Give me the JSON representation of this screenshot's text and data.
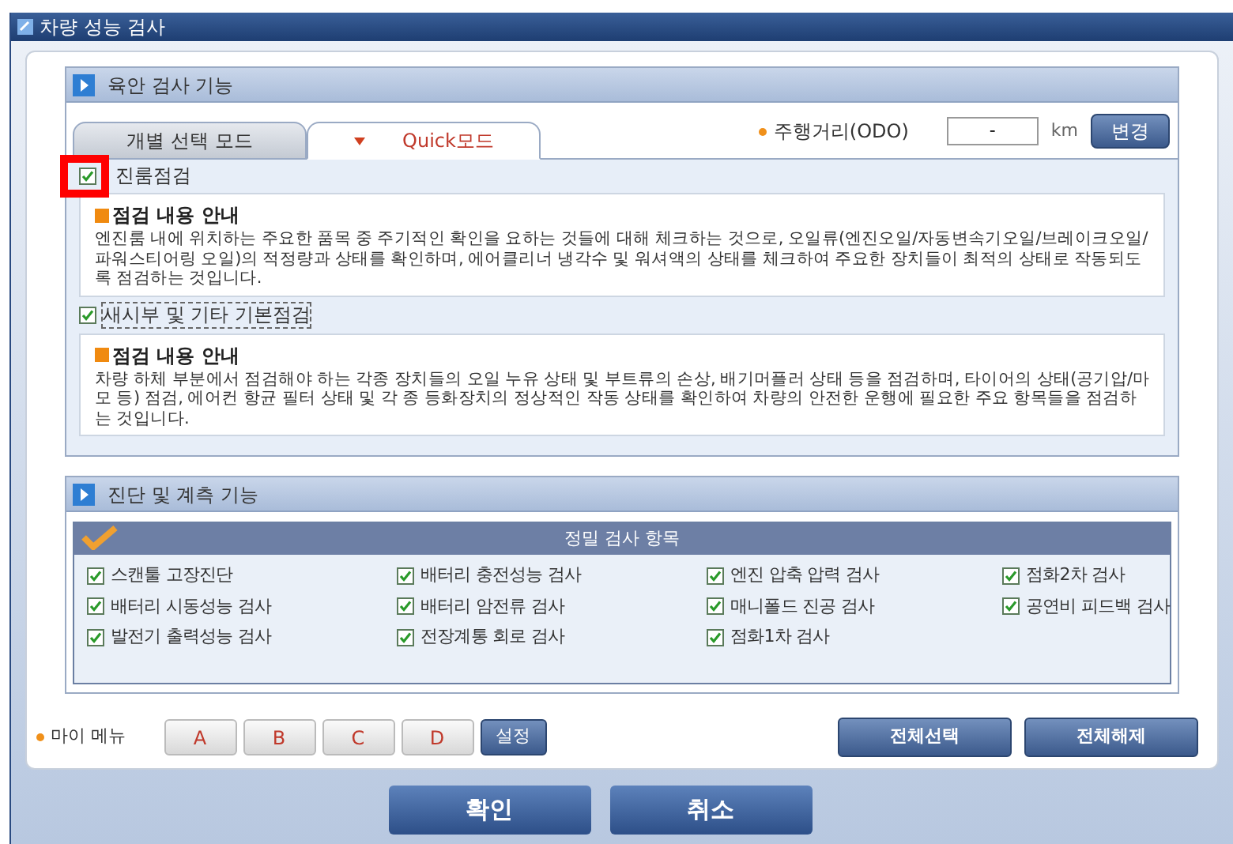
{
  "window": {
    "title": "차량 성능 검사"
  },
  "section1": {
    "title": "육안 검사 기능",
    "tabs": [
      {
        "label": "개별 선택 모드",
        "selected": false
      },
      {
        "label": "Quick모드",
        "selected": true
      }
    ],
    "odo": {
      "label": "주행거리(ODO)",
      "value": "-",
      "unit": "km",
      "button": "변경"
    },
    "groups": [
      {
        "label": "진룸점검",
        "checked": true,
        "highlighted": true,
        "info_title": "점검 내용 안내",
        "info_text": "엔진룸 내에 위치하는 주요한 품목 중 주기적인 확인을 요하는 것들에 대해 체크하는 것으로, 오일류(엔진오일/자동변속기오일/브레이크오일/파워스티어링 오일)의 적정량과 상태를 확인하며, 에어클리너 냉각수 및 워셔액의 상태를 체크하여 주요한 장치들이 최적의 상태로 작동되도록 점검하는 것입니다."
      },
      {
        "label": "새시부 및 기타 기본점검",
        "checked": true,
        "highlighted": false,
        "info_title": "점검 내용 안내",
        "info_text": "차량 하체 부분에서 점검해야 하는 각종 장치들의 오일 누유 상태 및 부트류의 손상, 배기머플러 상태 등을 점검하며, 타이어의 상태(공기압/마모 등) 점검, 에어컨 항균 필터 상태 및 각 종 등화장치의 정상적인 작동 상태를 확인하여 차량의 안전한 운행에 필요한 주요 항목들을 점검하는 것입니다."
      }
    ]
  },
  "section2": {
    "title": "진단 및 계측 기능",
    "panel_title": "정밀 검사 항목",
    "items": [
      {
        "label": "스캔툴 고장진단",
        "checked": true
      },
      {
        "label": "배터리 충전성능 검사",
        "checked": true
      },
      {
        "label": "엔진 압축 압력 검사",
        "checked": true
      },
      {
        "label": "점화2차 검사",
        "checked": true
      },
      {
        "label": "배터리 시동성능 검사",
        "checked": true
      },
      {
        "label": "배터리 암전류 검사",
        "checked": true
      },
      {
        "label": "매니폴드 진공 검사",
        "checked": true
      },
      {
        "label": "공연비 피드백 검사",
        "checked": true
      },
      {
        "label": "발전기 출력성능 검사",
        "checked": true
      },
      {
        "label": "전장계통 회로 검사",
        "checked": true
      },
      {
        "label": "점화1차 검사",
        "checked": true
      }
    ]
  },
  "my_menu": {
    "label": "마이 메뉴",
    "slots": [
      "A",
      "B",
      "C",
      "D"
    ],
    "settings": "설정"
  },
  "select_buttons": [
    "전체선택",
    "전체해제"
  ],
  "dialog_buttons": [
    "확인",
    "취소"
  ]
}
